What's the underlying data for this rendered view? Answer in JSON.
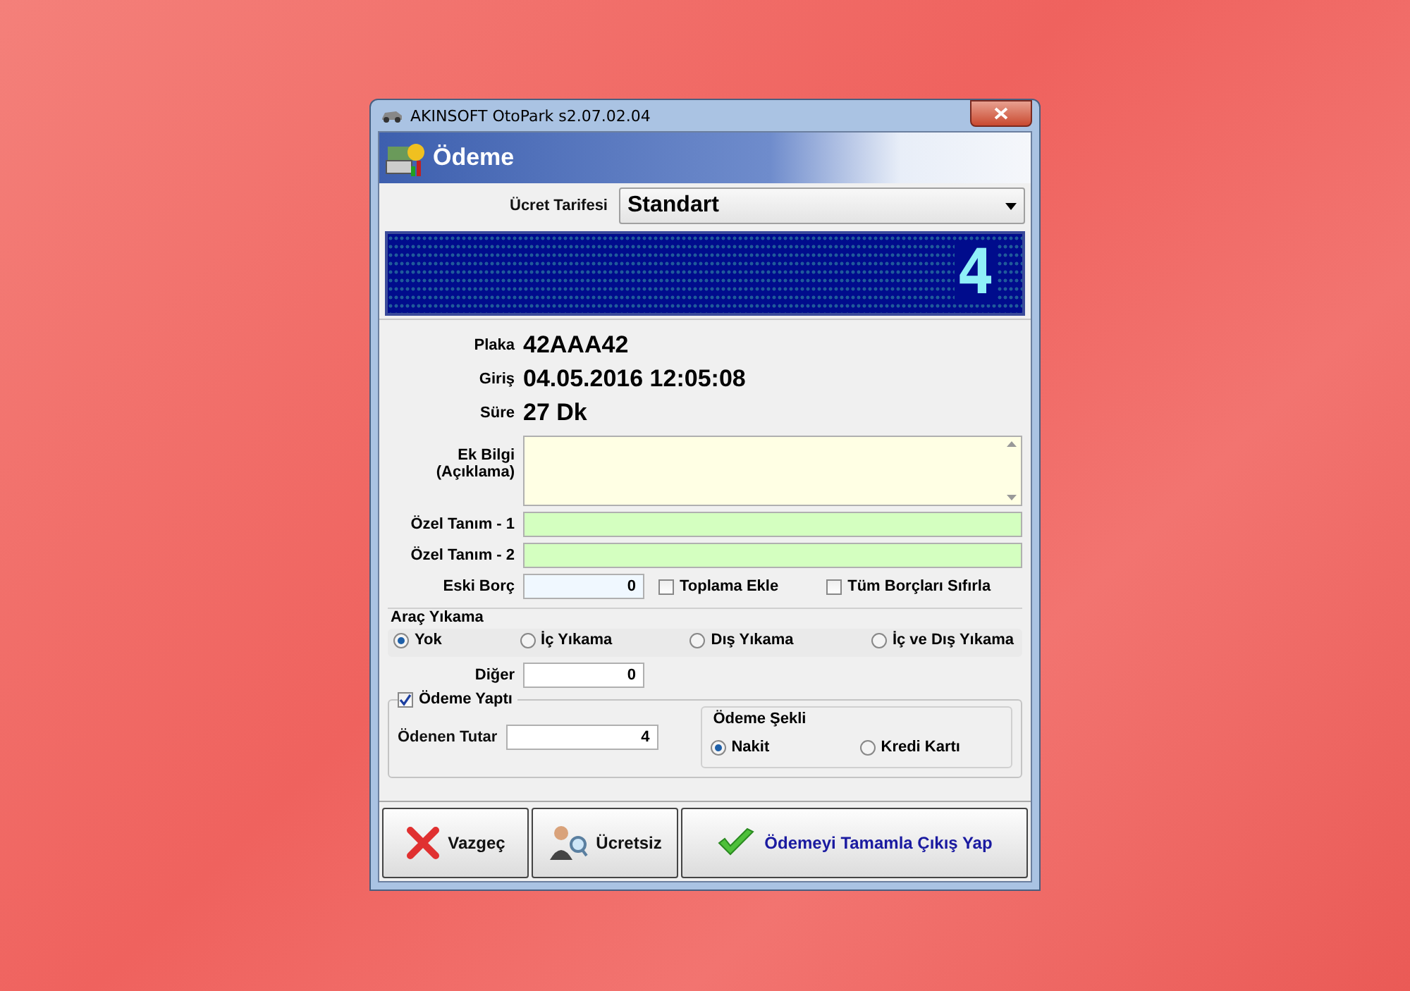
{
  "window": {
    "title": "AKINSOFT OtoPark s2.07.02.04"
  },
  "header": {
    "title": "Ödeme"
  },
  "tariff": {
    "label": "Ücret Tarifesi",
    "value": "Standart"
  },
  "display": {
    "text": "4"
  },
  "info": [
    {
      "label": "Plaka",
      "value": "42AAA42"
    },
    {
      "label": "Giriş",
      "value": "04.05.2016 12:05:08"
    },
    {
      "label": "Süre",
      "value": "27 Dk"
    }
  ],
  "note": {
    "label": "Ek Bilgi\n(Açıklama)"
  },
  "custom_fields": [
    {
      "label": "Özel Tanım - 1"
    },
    {
      "label": "Özel Tanım - 2"
    }
  ],
  "old_debt": {
    "label": "Eski Borç",
    "value": "0"
  },
  "debt_options": [
    {
      "label": "Toplama Ekle",
      "checked": false
    },
    {
      "label": "Tüm Borçları Sıfırla",
      "checked": false
    }
  ],
  "car_wash": {
    "title": "Araç Yıkama",
    "options": [
      {
        "label": "Yok",
        "selected": true
      },
      {
        "label": "İç Yıkama",
        "selected": false
      },
      {
        "label": "Dış Yıkama",
        "selected": false
      },
      {
        "label": "İç ve Dış Yıkama",
        "selected": false
      }
    ]
  },
  "other": {
    "label": "Diğer",
    "value": "0"
  },
  "payment": {
    "label": "Ödeme Yaptı",
    "checked": true,
    "amount_label": "Ödenen Tutar",
    "amount": "4",
    "method": {
      "title": "Ödeme Şekli",
      "options": [
        {
          "label": "Nakit",
          "selected": true
        },
        {
          "label": "Kredi Kartı",
          "selected": false
        }
      ]
    }
  },
  "buttons": [
    {
      "label": "Vazgeç",
      "kind": "cancel"
    },
    {
      "label": "Ücretsiz",
      "kind": "free"
    },
    {
      "label": "Ödemeyi Tamamla Çıkış Yap",
      "kind": "complete"
    }
  ]
}
